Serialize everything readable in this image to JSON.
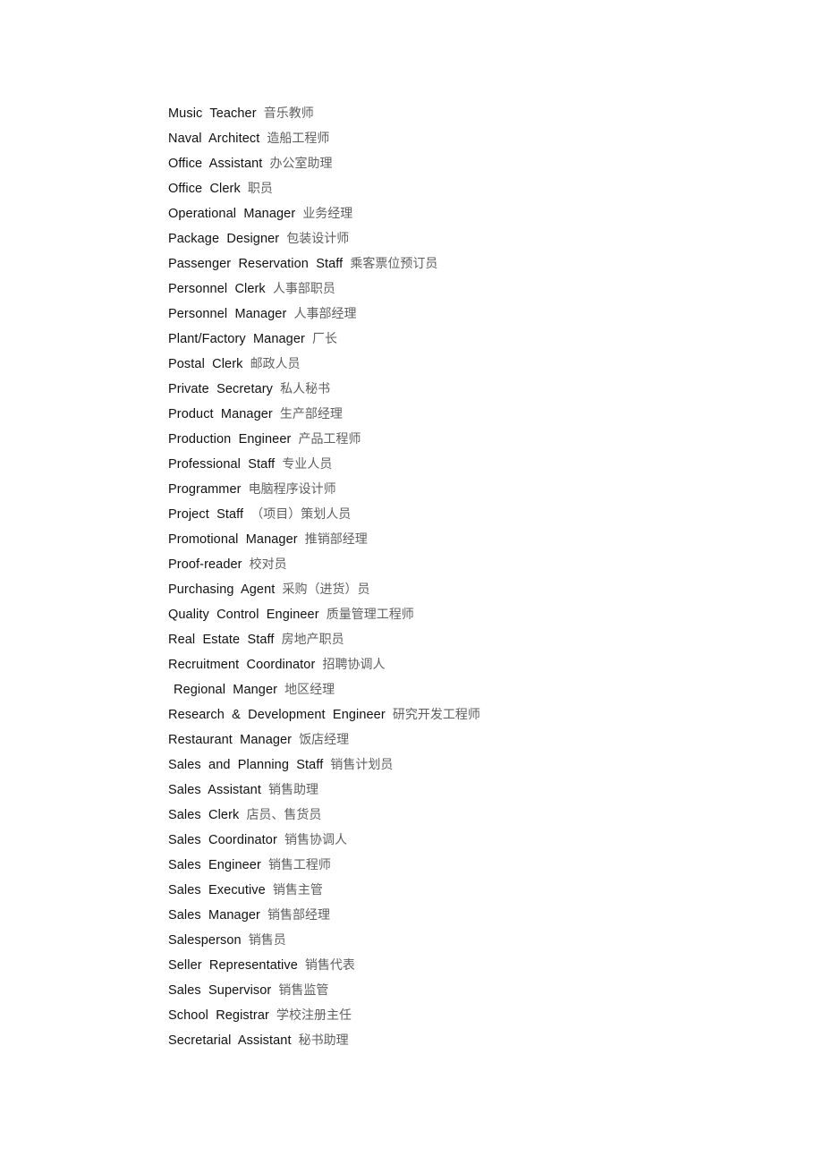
{
  "document": {
    "type": "bilingual-glossary",
    "language_pair": "English-Chinese",
    "subject": "job titles / occupations",
    "entries": [
      {
        "term": "Music  Teacher",
        "gloss": "音乐教师",
        "indented": false
      },
      {
        "term": "Naval  Architect",
        "gloss": "造船工程师",
        "indented": false
      },
      {
        "term": "Office  Assistant",
        "gloss": "办公室助理",
        "indented": false
      },
      {
        "term": "Office  Clerk",
        "gloss": "职员",
        "indented": false
      },
      {
        "term": "Operational  Manager",
        "gloss": "业务经理",
        "indented": false
      },
      {
        "term": "Package  Designer",
        "gloss": "包装设计师",
        "indented": false
      },
      {
        "term": "Passenger  Reservation  Staff",
        "gloss": "乘客票位预订员",
        "indented": false
      },
      {
        "term": "Personnel  Clerk",
        "gloss": "人事部职员",
        "indented": false
      },
      {
        "term": "Personnel  Manager",
        "gloss": "人事部经理",
        "indented": false
      },
      {
        "term": "Plant/Factory  Manager",
        "gloss": "厂长",
        "indented": false
      },
      {
        "term": "Postal  Clerk",
        "gloss": "邮政人员",
        "indented": false
      },
      {
        "term": "Private  Secretary",
        "gloss": "私人秘书",
        "indented": false
      },
      {
        "term": "Product  Manager",
        "gloss": "生产部经理",
        "indented": false
      },
      {
        "term": "Production  Engineer",
        "gloss": "产品工程师",
        "indented": false
      },
      {
        "term": "Professional  Staff",
        "gloss": "专业人员",
        "indented": false
      },
      {
        "term": "Programmer",
        "gloss": "电脑程序设计师",
        "indented": false
      },
      {
        "term": "Project  Staff",
        "gloss": "（项目）策划人员",
        "indented": false
      },
      {
        "term": "Promotional  Manager",
        "gloss": "推销部经理",
        "indented": false
      },
      {
        "term": "Proof-reader",
        "gloss": "校对员",
        "indented": false
      },
      {
        "term": "Purchasing  Agent",
        "gloss": "采购（进货）员",
        "indented": false
      },
      {
        "term": "Quality  Control  Engineer",
        "gloss": "质量管理工程师",
        "indented": false
      },
      {
        "term": "Real  Estate  Staff",
        "gloss": "房地产职员",
        "indented": false
      },
      {
        "term": "Recruitment  Coordinator",
        "gloss": "招聘协调人",
        "indented": false
      },
      {
        "term": "Regional  Manger",
        "gloss": "地区经理",
        "indented": true
      },
      {
        "term": "Research  &  Development  Engineer",
        "gloss": "研究开发工程师",
        "indented": false
      },
      {
        "term": "Restaurant  Manager",
        "gloss": "饭店经理",
        "indented": false
      },
      {
        "term": "Sales  and  Planning  Staff",
        "gloss": "销售计划员",
        "indented": false
      },
      {
        "term": "Sales  Assistant",
        "gloss": "销售助理",
        "indented": false
      },
      {
        "term": "Sales  Clerk",
        "gloss": "店员、售货员",
        "indented": false
      },
      {
        "term": "Sales  Coordinator",
        "gloss": "销售协调人",
        "indented": false
      },
      {
        "term": "Sales  Engineer",
        "gloss": "销售工程师",
        "indented": false
      },
      {
        "term": "Sales  Executive",
        "gloss": "销售主管",
        "indented": false
      },
      {
        "term": "Sales  Manager",
        "gloss": "销售部经理",
        "indented": false
      },
      {
        "term": "Salesperson",
        "gloss": "销售员",
        "indented": false
      },
      {
        "term": "Seller  Representative",
        "gloss": "销售代表",
        "indented": false
      },
      {
        "term": "Sales  Supervisor",
        "gloss": "销售监管",
        "indented": false
      },
      {
        "term": "School  Registrar",
        "gloss": "学校注册主任",
        "indented": false
      },
      {
        "term": "Secretarial  Assistant",
        "gloss": "秘书助理",
        "indented": false
      }
    ]
  },
  "colors": {
    "page_background": "#ffffff",
    "term_text": "#111111",
    "gloss_text": "#5f5f5f"
  }
}
